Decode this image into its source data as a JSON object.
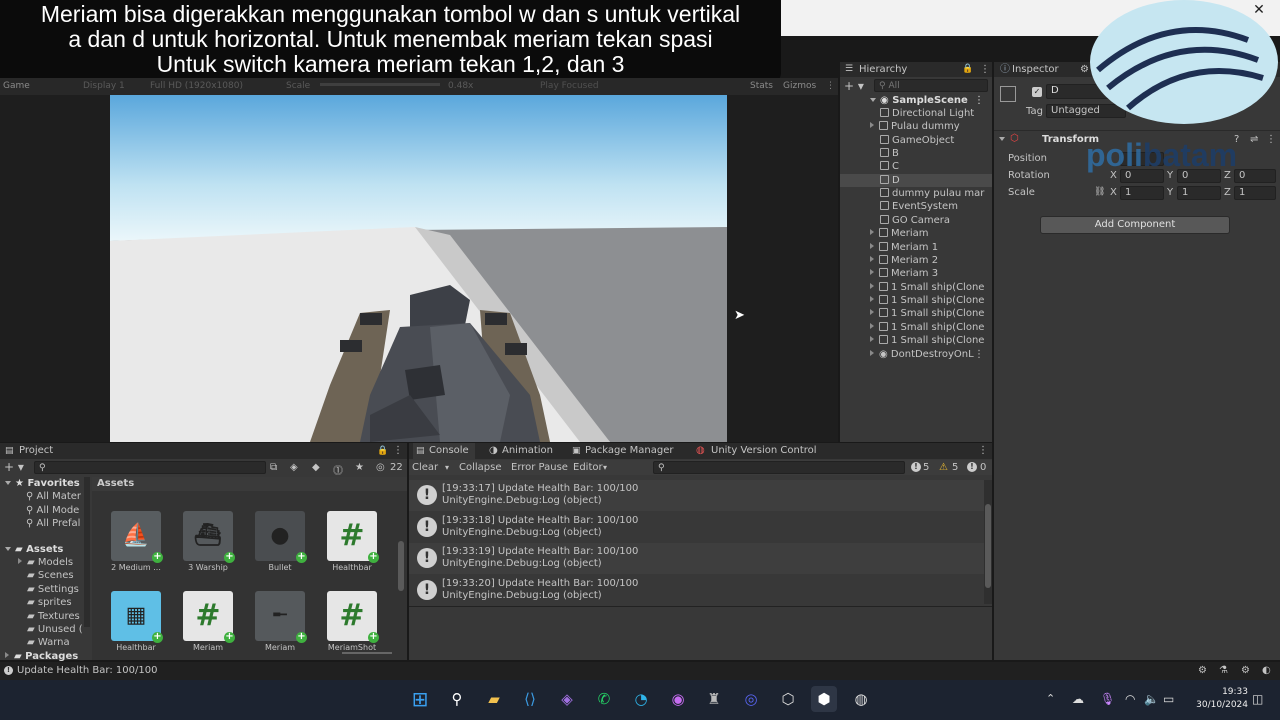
{
  "caption": {
    "line1": "Meriam bisa digerakkan menggunakan tombol w dan s untuk vertikal",
    "line2": "a dan d untuk horizontal. Untuk menembak meriam tekan spasi",
    "line3": "Untuk switch kamera meriam tekan 1,2, dan 3"
  },
  "game_toolbar": {
    "tab": "Game",
    "display": "Display 1",
    "resolution": "Full HD (1920x1080)",
    "scale_label": "Scale",
    "scale_value": "0.48x",
    "play_focused": "Play Focused",
    "stats": "Stats",
    "gizmos": "Gizmos"
  },
  "hierarchy": {
    "title": "Hierarchy",
    "search_placeholder": "All",
    "scene": "SampleScene",
    "items": [
      {
        "label": "Directional Light",
        "expandable": false
      },
      {
        "label": "Pulau dummy",
        "expandable": true
      },
      {
        "label": "GameObject",
        "expandable": false
      },
      {
        "label": "B",
        "expandable": false
      },
      {
        "label": "C",
        "expandable": false
      },
      {
        "label": "D",
        "expandable": false,
        "selected": true
      },
      {
        "label": "dummy pulau mar",
        "expandable": false
      },
      {
        "label": "EventSystem",
        "expandable": false
      },
      {
        "label": "GO Camera",
        "expandable": false
      },
      {
        "label": "Meriam",
        "expandable": true
      },
      {
        "label": "Meriam 1",
        "expandable": true
      },
      {
        "label": "Meriam 2",
        "expandable": true
      },
      {
        "label": "Meriam 3",
        "expandable": true
      },
      {
        "label": "1 Small ship(Clone",
        "expandable": true
      },
      {
        "label": "1 Small ship(Clone",
        "expandable": true
      },
      {
        "label": "1 Small ship(Clone",
        "expandable": true
      },
      {
        "label": "1 Small ship(Clone",
        "expandable": true
      },
      {
        "label": "1 Small ship(Clone",
        "expandable": true
      }
    ],
    "dont_destroy": "DontDestroyOnL"
  },
  "inspector": {
    "title": "Inspector",
    "object_name": "D",
    "tag_label": "Tag",
    "tag_value": "Untagged",
    "transform": "Transform",
    "position_label": "Position",
    "rotation_label": "Rotation",
    "scale_label": "Scale",
    "rotation": {
      "x": "0",
      "y": "0",
      "z": "0"
    },
    "scale": {
      "x": "1",
      "y": "1",
      "z": "1"
    },
    "axis_x": "X",
    "axis_y": "Y",
    "axis_z": "Z",
    "add_component": "Add Component"
  },
  "logo": {
    "text_a": "poli",
    "text_b": "batam"
  },
  "project": {
    "title": "Project",
    "count": "22",
    "favorites": "Favorites",
    "favorites_items": [
      "All Mater",
      "All Mode",
      "All Prefal"
    ],
    "assets": "Assets",
    "assets_items": [
      "Models",
      "Scenes",
      "Settings",
      "sprites",
      "Textures",
      "Unused (",
      "Warna"
    ],
    "packages": "Packages",
    "breadcrumb": "Assets",
    "tiles": [
      {
        "label": "2 Medium ..."
      },
      {
        "label": "3 Warship"
      },
      {
        "label": "Bullet"
      },
      {
        "label": "Healthbar"
      },
      {
        "label": "Healthbar"
      },
      {
        "label": "Meriam"
      },
      {
        "label": "Meriam"
      },
      {
        "label": "MeriamShot"
      }
    ]
  },
  "console": {
    "tabs": [
      "Console",
      "Animation",
      "Package Manager",
      "Unity Version Control"
    ],
    "clear": "Clear",
    "collapse": "Collapse",
    "error_pause": "Error Pause",
    "editor": "Editor",
    "count_info": "5",
    "count_warn": "5",
    "count_error": "0",
    "entries": [
      {
        "line1": "[19:33:17] Update Health Bar: 100/100",
        "line2": "UnityEngine.Debug:Log (object)"
      },
      {
        "line1": "[19:33:18] Update Health Bar: 100/100",
        "line2": "UnityEngine.Debug:Log (object)"
      },
      {
        "line1": "[19:33:19] Update Health Bar: 100/100",
        "line2": "UnityEngine.Debug:Log (object)"
      },
      {
        "line1": "[19:33:20] Update Health Bar: 100/100",
        "line2": "UnityEngine.Debug:Log (object)"
      }
    ]
  },
  "status_bar": {
    "message": "Update Health Bar: 100/100"
  },
  "taskbar": {
    "time": "19:33",
    "date": "30/10/2024"
  },
  "colors": {
    "sky_top": "#5aa7dc",
    "sky_bottom": "#e8f4f8",
    "accent": "#2c5d87"
  }
}
